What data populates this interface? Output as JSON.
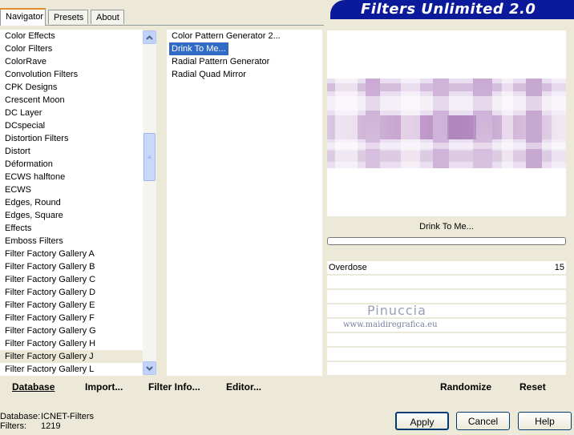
{
  "banner_title": "Filters Unlimited 2.0",
  "tabs": [
    "Navigator",
    "Presets",
    "About"
  ],
  "categories": [
    "Color Effects",
    "Color Filters",
    "ColorRave",
    "Convolution Filters",
    "CPK Designs",
    "Crescent Moon",
    "DC Layer",
    "DCspecial",
    "Distortion Filters",
    "Distort",
    "Déformation",
    "ECWS halftone",
    "ECWS",
    "Edges, Round",
    "Edges, Square",
    "Effects",
    "Emboss Filters",
    "Filter Factory Gallery A",
    "Filter Factory Gallery B",
    "Filter Factory Gallery C",
    "Filter Factory Gallery D",
    "Filter Factory Gallery E",
    "Filter Factory Gallery F",
    "Filter Factory Gallery G",
    "Filter Factory Gallery H",
    "Filter Factory Gallery J",
    "Filter Factory Gallery L"
  ],
  "selected_category": "Filter Factory Gallery J",
  "filters": [
    "Color Pattern Generator 2...",
    "Drink To Me...",
    "Radial Pattern Generator",
    "Radial Quad Mirror"
  ],
  "selected_filter": "Drink To Me...",
  "filter_name_display": "Drink To Me...",
  "param": {
    "name": "Overdose",
    "value": "15"
  },
  "watermark": {
    "name": "Pinuccia",
    "url": "www.maidiregrafica.eu"
  },
  "bottom_buttons": [
    "Database",
    "Import...",
    "Filter Info...",
    "Editor..."
  ],
  "right_buttons": [
    "Randomize",
    "Reset"
  ],
  "info": {
    "database_label": "Database:",
    "database_value": "ICNET-Filters",
    "filters_label": "Filters:",
    "filters_value": "1219"
  },
  "dialog_buttons": {
    "apply": "Apply",
    "cancel": "Cancel",
    "help": "Help"
  },
  "colors": {
    "banner": "#0a1a9a",
    "selection": "#316ac5",
    "pattern": "#b98fc4"
  }
}
